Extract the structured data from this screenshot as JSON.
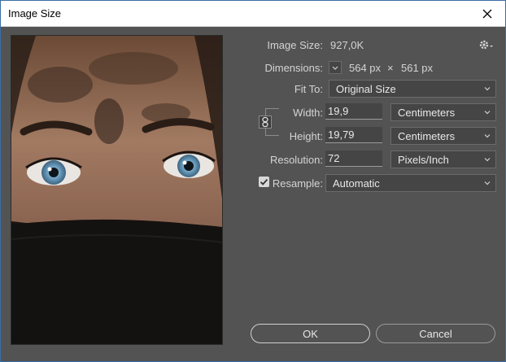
{
  "window": {
    "title": "Image Size"
  },
  "info": {
    "image_size_label": "Image Size:",
    "image_size_value": "927,0K",
    "dimensions_label": "Dimensions:",
    "dimensions_width": "564 px",
    "dimensions_times": "×",
    "dimensions_height": "561 px"
  },
  "fit_to": {
    "label": "Fit To:",
    "value": "Original Size"
  },
  "width": {
    "label": "Width:",
    "value": "19,9",
    "unit": "Centimeters"
  },
  "height": {
    "label": "Height:",
    "value": "19,79",
    "unit": "Centimeters"
  },
  "resolution": {
    "label": "Resolution:",
    "value": "72",
    "unit": "Pixels/Inch"
  },
  "resample": {
    "label": "Resample:",
    "checked": true,
    "value": "Automatic"
  },
  "buttons": {
    "ok": "OK",
    "cancel": "Cancel"
  },
  "icons": {
    "close": "close-icon",
    "settings": "gear-icon",
    "link": "chain-link-icon",
    "chevron": "chevron-down-icon",
    "check": "checkmark-icon"
  }
}
